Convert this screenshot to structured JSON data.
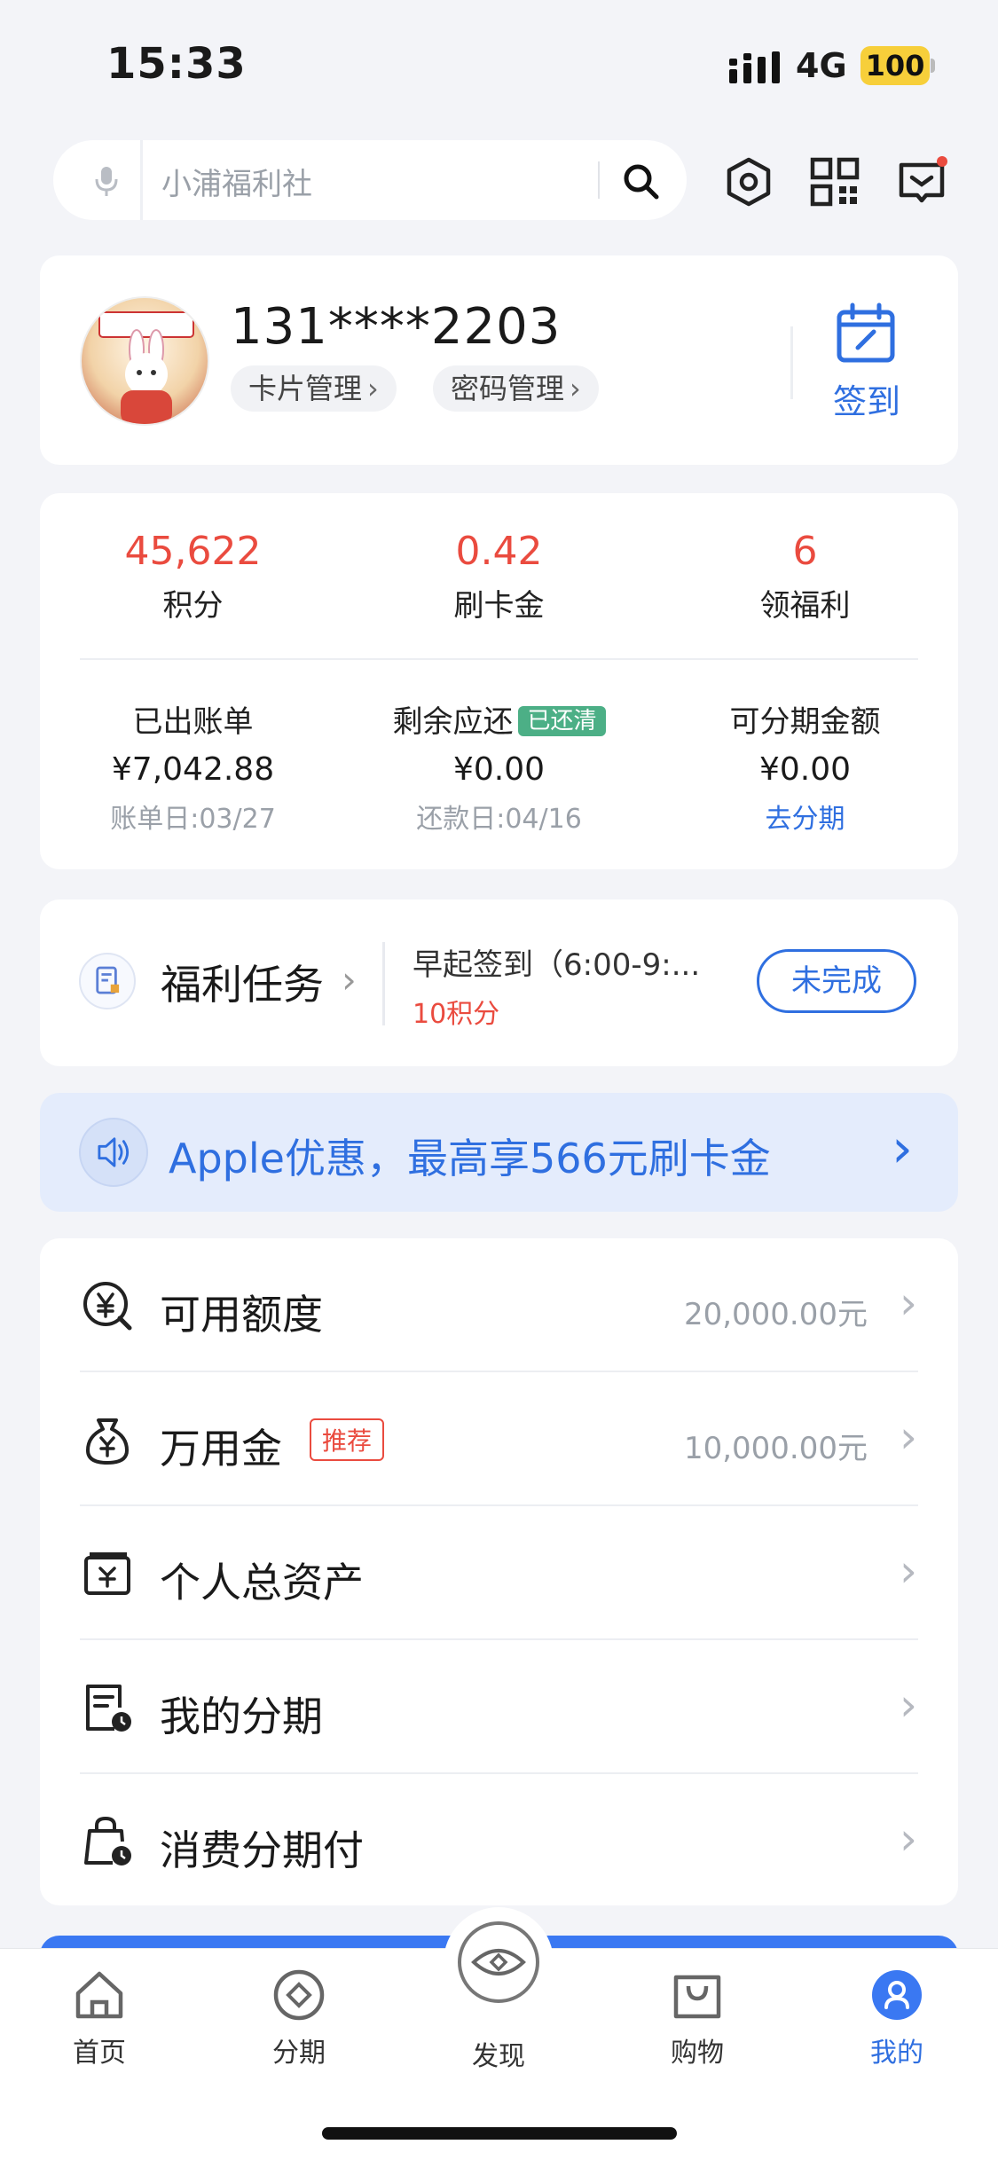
{
  "status": {
    "time": "15:33",
    "network": "4G",
    "battery": "100"
  },
  "search": {
    "placeholder": "小浦福利社"
  },
  "profile": {
    "phone": "131****2203",
    "card_manage": "卡片管理",
    "pwd_manage": "密码管理",
    "signin": "签到"
  },
  "stats": [
    {
      "value": "45,622",
      "label": "积分"
    },
    {
      "value": "0.42",
      "label": "刷卡金"
    },
    {
      "value": "6",
      "label": "领福利"
    }
  ],
  "bills": [
    {
      "title": "已出账单",
      "value": "¥7,042.88",
      "sub": "账单日:03/27"
    },
    {
      "title": "剩余应还",
      "tag": "已还清",
      "value": "¥0.00",
      "sub": "还款日:04/16"
    },
    {
      "title": "可分期金额",
      "value": "¥0.00",
      "link": "去分期"
    }
  ],
  "tasks": {
    "title": "福利任务",
    "name": "早起签到（6:00-9:...",
    "points": "10积分",
    "button": "未完成"
  },
  "banner": {
    "text": "Apple优惠，最高享566元刷卡金"
  },
  "menu": [
    {
      "label": "可用额度",
      "value": "20,000.00元",
      "icon": "yen-coin-search-icon"
    },
    {
      "label": "万用金",
      "tag": "推荐",
      "value": "10,000.00元",
      "icon": "money-bag-icon"
    },
    {
      "label": "个人总资产",
      "value": "",
      "icon": "wallet-card-icon"
    },
    {
      "label": "我的分期",
      "value": "",
      "icon": "document-clock-icon"
    },
    {
      "label": "消费分期付",
      "value": "",
      "icon": "shopping-bag-clock-icon"
    }
  ],
  "tabs": [
    {
      "label": "首页",
      "icon": "home-icon"
    },
    {
      "label": "分期",
      "icon": "diamond-circle-icon"
    },
    {
      "label": "发现",
      "icon": "eye-icon"
    },
    {
      "label": "购物",
      "icon": "shopping-bag-icon"
    },
    {
      "label": "我的",
      "icon": "user-icon",
      "active": true
    }
  ],
  "colors": {
    "accent": "#2f6fe0",
    "red": "#ea4b3f",
    "green": "#4caf86",
    "bg": "#f3f4f8"
  }
}
